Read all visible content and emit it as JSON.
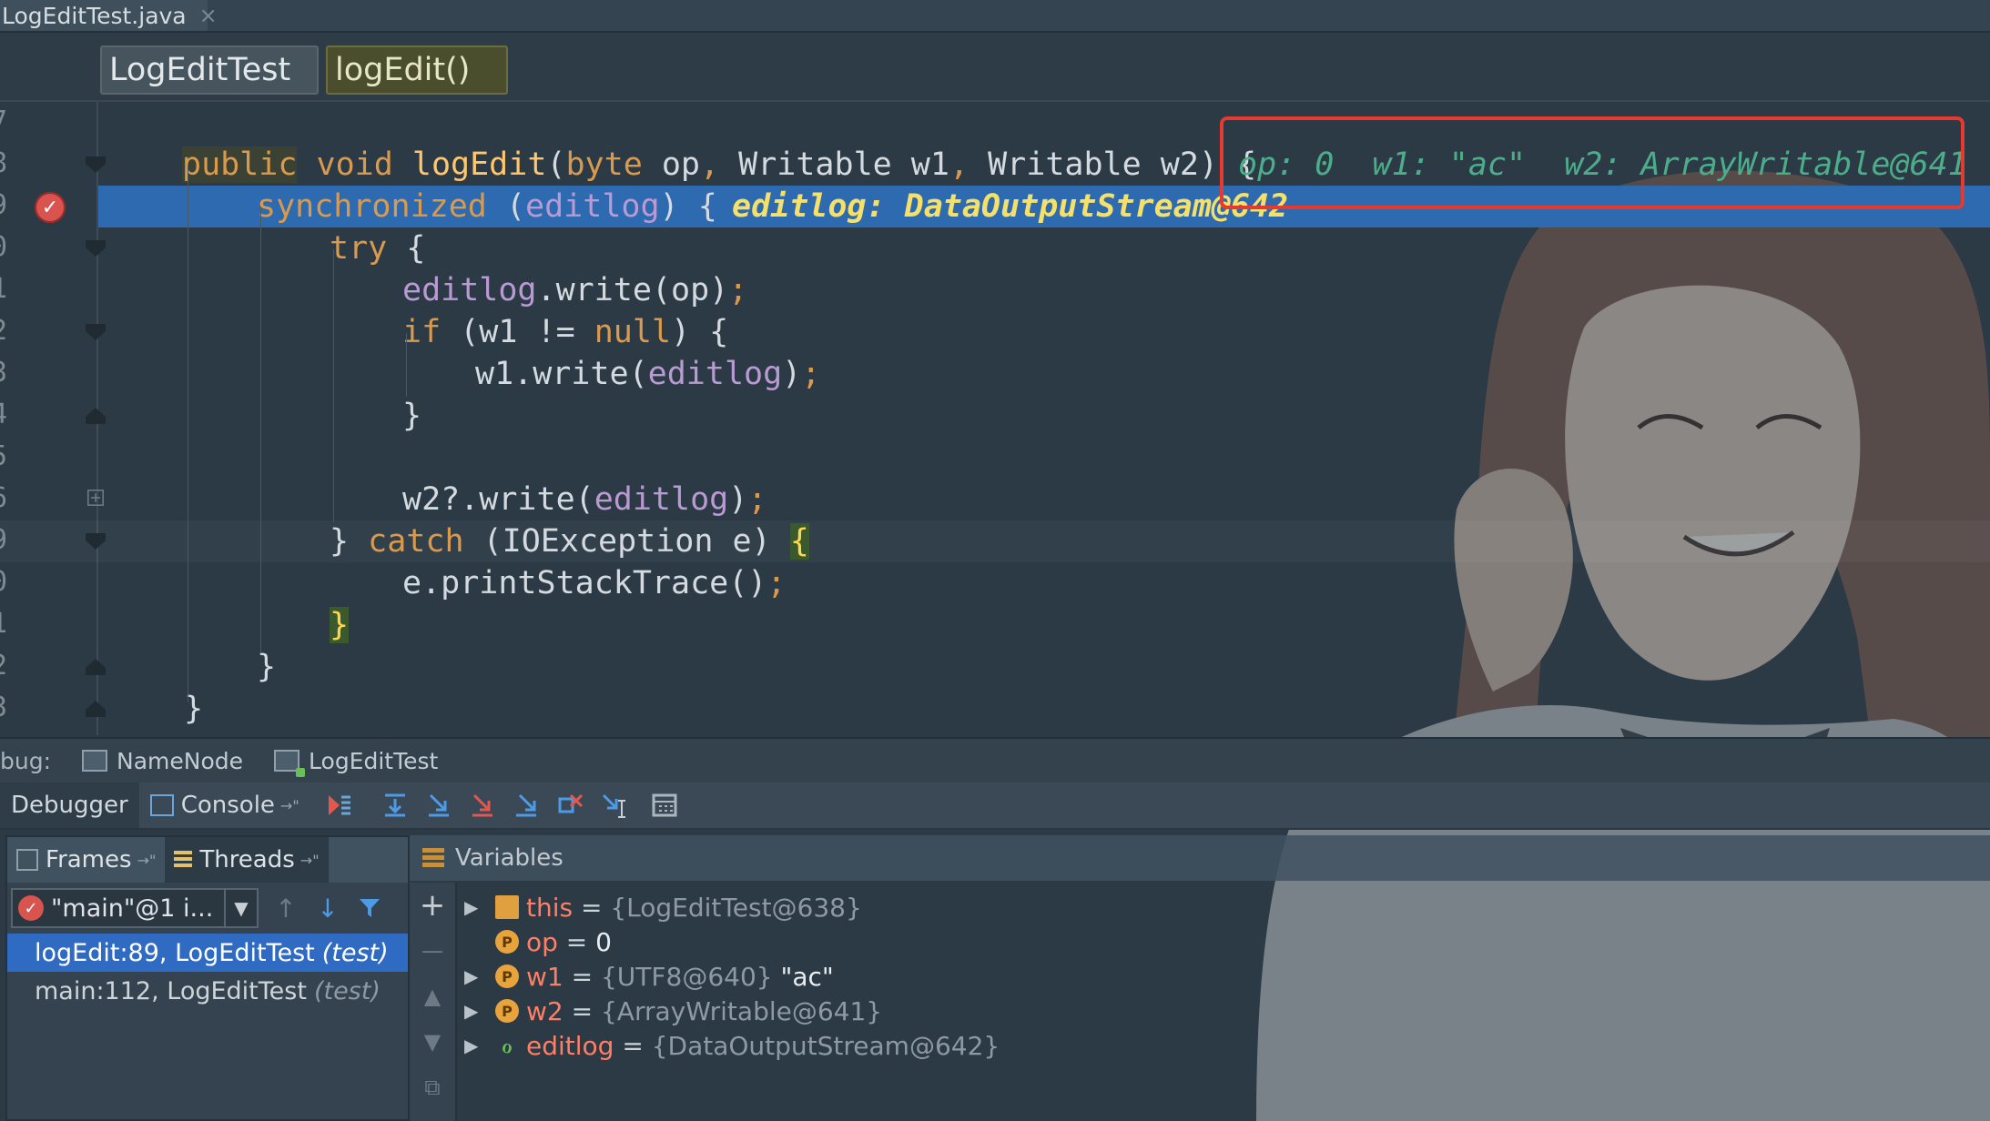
{
  "file_tab": {
    "name": "LogEditTest.java",
    "close": "×"
  },
  "breadcrumb": {
    "class_name": "LogEditTest",
    "method_name": "logEdit()"
  },
  "editor": {
    "lines": [
      {
        "num": "7",
        "code": ""
      },
      {
        "num": "8",
        "code": "public void logEdit(byte op, Writable w1, Writable w2) {",
        "inline": "op: 0  w1: \"ac\"  w2: ArrayWritable@641"
      },
      {
        "num": "9",
        "code": "synchronized (editlog) {",
        "inline": "editlog: DataOutputStream@642"
      },
      {
        "num": "0",
        "code": "try {"
      },
      {
        "num": "1",
        "code": "editlog.write(op);"
      },
      {
        "num": "2",
        "code": "if (w1 != null) {"
      },
      {
        "num": "3",
        "code": "w1.write(editlog);"
      },
      {
        "num": "4",
        "code": "}"
      },
      {
        "num": "5",
        "code": ""
      },
      {
        "num": "6",
        "code": "w2?.write(editlog);"
      },
      {
        "num": "9",
        "code": "} catch (IOException e) {"
      },
      {
        "num": "0",
        "code": "e.printStackTrace();"
      },
      {
        "num": "1",
        "code": "}"
      },
      {
        "num": "2",
        "code": "}"
      },
      {
        "num": "3",
        "code": "}"
      }
    ]
  },
  "debug_bar": {
    "label": "bug:",
    "sessions": [
      "NameNode",
      "LogEditTest"
    ]
  },
  "debugger_toolbar": {
    "debugger_tab": "Debugger",
    "console_tab": "Console",
    "pin": "→\"",
    "icons": [
      "show-execution-point-icon",
      "step-over-icon",
      "step-into-icon",
      "force-step-into-icon",
      "step-out-icon",
      "drop-frame-icon",
      "run-to-cursor-icon",
      "evaluate-expression-icon"
    ]
  },
  "frames_panel": {
    "frames_tab": "Frames",
    "threads_tab": "Threads",
    "pin": "→\"",
    "thread_selected": "\"main\"@1 i...",
    "frames": [
      {
        "method": "logEdit:89, LogEditTest",
        "pkg": "(test)",
        "selected": true
      },
      {
        "method": "main:112, LogEditTest",
        "pkg": "(test)",
        "selected": false
      }
    ]
  },
  "variables_panel": {
    "title": "Variables",
    "vars": [
      {
        "name": "this",
        "eq": " = ",
        "value": "{LogEditTest@638}",
        "extra": "",
        "icon": "stack",
        "expandable": true
      },
      {
        "name": "op",
        "eq": " = ",
        "value": "0",
        "extra": "",
        "icon": "P",
        "expandable": false
      },
      {
        "name": "w1",
        "eq": " = ",
        "value": "{UTF8@640}",
        "extra": " \"ac\"",
        "icon": "P",
        "expandable": true
      },
      {
        "name": "w2",
        "eq": " = ",
        "value": "{ArrayWritable@641}",
        "extra": "",
        "icon": "P",
        "expandable": true
      },
      {
        "name": "editlog",
        "eq": " = ",
        "value": "{DataOutputStream@642}",
        "extra": "",
        "icon": "watch",
        "expandable": true
      }
    ]
  },
  "colors": {
    "breakpoint_line": "#2e6ab0",
    "annotation_box": "#e8392e",
    "keyword": "#d99a4e",
    "inline_value": "#4cad8a"
  }
}
